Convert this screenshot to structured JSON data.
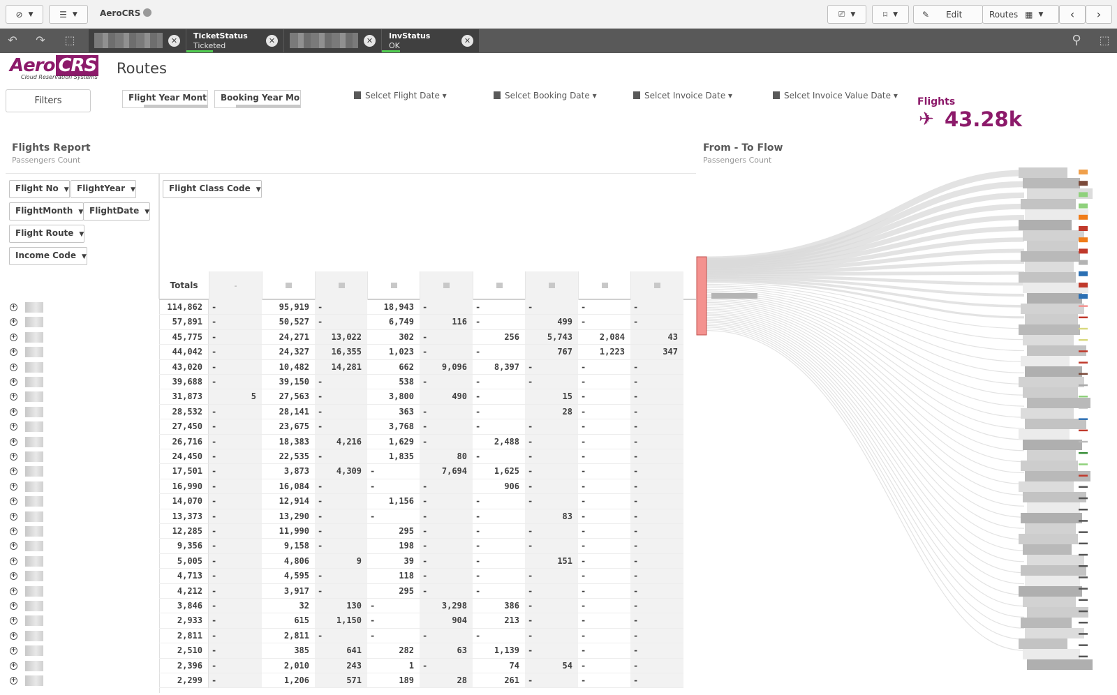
{
  "toolbar": {
    "app_name": "AeroCRS",
    "edit_label": "Edit",
    "sheet_label": "Routes"
  },
  "selections": [
    {
      "name": "",
      "value": ""
    },
    {
      "name": "TicketStatus",
      "value": "Ticketed"
    },
    {
      "name": "",
      "value": ""
    },
    {
      "name": "InvStatus",
      "value": "OK"
    }
  ],
  "logo": {
    "brand": "Aero",
    "brand_box": "CRS",
    "tagline": "Cloud Reservation Systems"
  },
  "sheet": {
    "title": "Routes"
  },
  "filters": {
    "button_label": "Filters",
    "panes": [
      "Flight Year Month",
      "Booking Year Mo..."
    ],
    "date_pickers": [
      "Selcet Flight Date",
      "Selcet Booking Date",
      "Selcet Invoice Date",
      "Selcet Invoice Value Date"
    ]
  },
  "kpi": {
    "label": "Flights",
    "value": "43.28k"
  },
  "report": {
    "title": "Flights Report",
    "subtitle": "Passengers Count",
    "row_dims": [
      "Flight No",
      "FlightYear",
      "FlightMonth",
      "FlightDate",
      "Flight Route",
      "Income Code"
    ],
    "col_dims": [
      "Flight Class Code"
    ],
    "totals_label": "Totals",
    "first_col_header": "-",
    "rows": [
      [
        "114,862",
        "-",
        "95,919",
        "-",
        "18,943",
        "-",
        "-",
        "-",
        "-",
        "-"
      ],
      [
        "57,891",
        "-",
        "50,527",
        "-",
        "6,749",
        "116",
        "-",
        "499",
        "-",
        "-"
      ],
      [
        "45,775",
        "-",
        "24,271",
        "13,022",
        "302",
        "-",
        "256",
        "5,743",
        "2,084",
        "43"
      ],
      [
        "44,042",
        "-",
        "24,327",
        "16,355",
        "1,023",
        "-",
        "-",
        "767",
        "1,223",
        "347"
      ],
      [
        "43,020",
        "-",
        "10,482",
        "14,281",
        "662",
        "9,096",
        "8,397",
        "-",
        "-",
        "-"
      ],
      [
        "39,688",
        "-",
        "39,150",
        "-",
        "538",
        "-",
        "-",
        "-",
        "-",
        "-"
      ],
      [
        "31,873",
        "5",
        "27,563",
        "-",
        "3,800",
        "490",
        "-",
        "15",
        "-",
        "-"
      ],
      [
        "28,532",
        "-",
        "28,141",
        "-",
        "363",
        "-",
        "-",
        "28",
        "-",
        "-"
      ],
      [
        "27,450",
        "-",
        "23,675",
        "-",
        "3,768",
        "-",
        "-",
        "-",
        "-",
        "-"
      ],
      [
        "26,716",
        "-",
        "18,383",
        "4,216",
        "1,629",
        "-",
        "2,488",
        "-",
        "-",
        "-"
      ],
      [
        "24,450",
        "-",
        "22,535",
        "-",
        "1,835",
        "80",
        "-",
        "-",
        "-",
        "-"
      ],
      [
        "17,501",
        "-",
        "3,873",
        "4,309",
        "-",
        "7,694",
        "1,625",
        "-",
        "-",
        "-"
      ],
      [
        "16,990",
        "-",
        "16,084",
        "-",
        "-",
        "-",
        "906",
        "-",
        "-",
        "-"
      ],
      [
        "14,070",
        "-",
        "12,914",
        "-",
        "1,156",
        "-",
        "-",
        "-",
        "-",
        "-"
      ],
      [
        "13,373",
        "-",
        "13,290",
        "-",
        "-",
        "-",
        "-",
        "83",
        "-",
        "-"
      ],
      [
        "12,285",
        "-",
        "11,990",
        "-",
        "295",
        "-",
        "-",
        "-",
        "-",
        "-"
      ],
      [
        "9,356",
        "-",
        "9,158",
        "-",
        "198",
        "-",
        "-",
        "-",
        "-",
        "-"
      ],
      [
        "5,005",
        "-",
        "4,806",
        "9",
        "39",
        "-",
        "-",
        "151",
        "-",
        "-"
      ],
      [
        "4,713",
        "-",
        "4,595",
        "-",
        "118",
        "-",
        "-",
        "-",
        "-",
        "-"
      ],
      [
        "4,212",
        "-",
        "3,917",
        "-",
        "295",
        "-",
        "-",
        "-",
        "-",
        "-"
      ],
      [
        "3,846",
        "-",
        "32",
        "130",
        "-",
        "3,298",
        "386",
        "-",
        "-",
        "-"
      ],
      [
        "2,933",
        "-",
        "615",
        "1,150",
        "-",
        "904",
        "213",
        "-",
        "-",
        "-"
      ],
      [
        "2,811",
        "-",
        "2,811",
        "-",
        "-",
        "-",
        "-",
        "-",
        "-",
        "-"
      ],
      [
        "2,510",
        "-",
        "385",
        "641",
        "282",
        "63",
        "1,139",
        "-",
        "-",
        "-"
      ],
      [
        "2,396",
        "-",
        "2,010",
        "243",
        "1",
        "-",
        "74",
        "54",
        "-",
        "-"
      ],
      [
        "2,299",
        "-",
        "1,206",
        "571",
        "189",
        "28",
        "261",
        "-",
        "-",
        "-"
      ]
    ]
  },
  "flow": {
    "title": "From - To Flow",
    "subtitle": "Passengers Count",
    "accent": "#f4928f",
    "target_colors": [
      "#f0a04b",
      "#7b4a3a",
      "#8fd17c",
      "#8fd17c",
      "#f07d1a",
      "#c0392b",
      "#f07d1a",
      "#c0392b",
      "#b3b3b3",
      "#2b6fb3",
      "#c0392b",
      "#2b6fb3",
      "#f4928f",
      "#c0392b",
      "#d9d980",
      "#d9d980",
      "#c0392b",
      "#c0392b",
      "#7b4a3a",
      "#aaaaaa",
      "#8fd17c",
      "#bbbbbb",
      "#2b6fb3",
      "#c0392b",
      "#bbbbbb",
      "#3a8f3a",
      "#8fd17c",
      "#c0392b"
    ]
  },
  "colors": {
    "brand": "#8c1a6a",
    "selection_bar": "#595959",
    "chip": "#404040",
    "ok_green": "#52cc52"
  }
}
